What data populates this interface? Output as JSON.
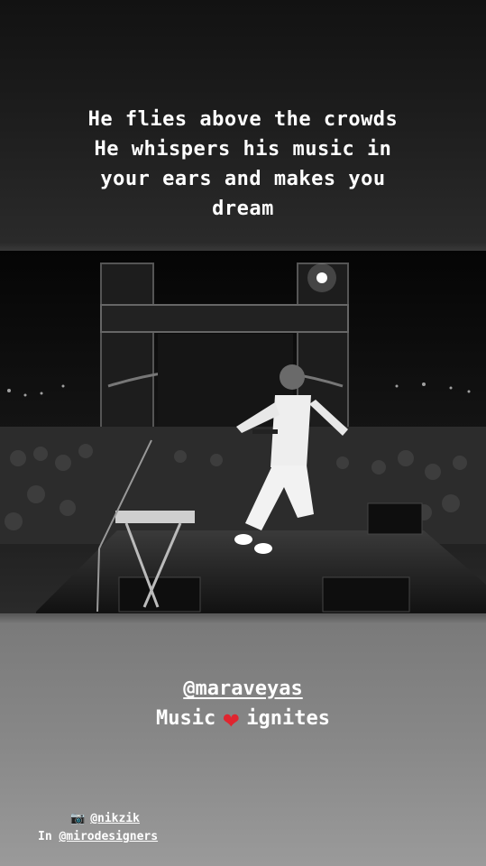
{
  "story": {
    "caption_lines": [
      "He flies above the crowds",
      "He whispers his music in",
      "your ears and makes you",
      "dream"
    ],
    "photo": {
      "description_icon": "concert-photo",
      "colors": {
        "sky": "#0b0b0b",
        "crowd": "#2b2b2b",
        "stage": "#1a1a1a",
        "suit": "#f0f0f0"
      }
    },
    "mention": "@maraveyas",
    "tagline_before": "Music",
    "tagline_emoji": "❤",
    "tagline_after": "ignites",
    "credit_photo_handle": "@nikzik",
    "credit_in_prefix": "In",
    "credit_in_handle": "@mirodesigners",
    "camera_icon": "📷"
  }
}
